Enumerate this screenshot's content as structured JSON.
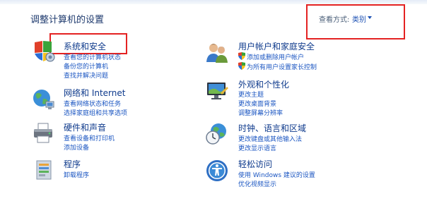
{
  "header": {
    "title": "调整计算机的设置",
    "view_by_label": "查看方式:",
    "view_by_value": "类别"
  },
  "categories": {
    "system_security": {
      "title": "系统和安全",
      "links": [
        "查看您的计算机状态",
        "备份您的计算机",
        "查找并解决问题"
      ],
      "icon": "shield-flag-icon"
    },
    "network": {
      "title": "网络和 Internet",
      "links": [
        "查看网络状态和任务",
        "选择家庭组和共享选项"
      ],
      "icon": "network-globe-icon"
    },
    "hardware": {
      "title": "硬件和声音",
      "links": [
        "查看设备和打印机",
        "添加设备"
      ],
      "icon": "printer-icon"
    },
    "programs": {
      "title": "程序",
      "links": [
        "卸载程序"
      ],
      "icon": "programs-icon"
    },
    "user_accounts": {
      "title": "用户帐户和家庭安全",
      "links": [
        "添加或删除用户帐户",
        "为所有用户设置家长控制"
      ],
      "icon": "users-icon"
    },
    "appearance": {
      "title": "外观和个性化",
      "links": [
        "更改主题",
        "更改桌面背景",
        "调整屏幕分辨率"
      ],
      "icon": "monitor-icon"
    },
    "clock_region": {
      "title": "时钟、语言和区域",
      "links": [
        "更改键盘或其他输入法",
        "更改显示语言"
      ],
      "icon": "clock-globe-icon"
    },
    "ease_access": {
      "title": "轻松访问",
      "links": [
        "使用 Windows 建议的设置",
        "优化视频显示"
      ],
      "icon": "accessibility-icon"
    }
  },
  "colors": {
    "title_link": "#0e3a8c",
    "sub_link": "#1b56c2",
    "highlight": "#e42222"
  }
}
